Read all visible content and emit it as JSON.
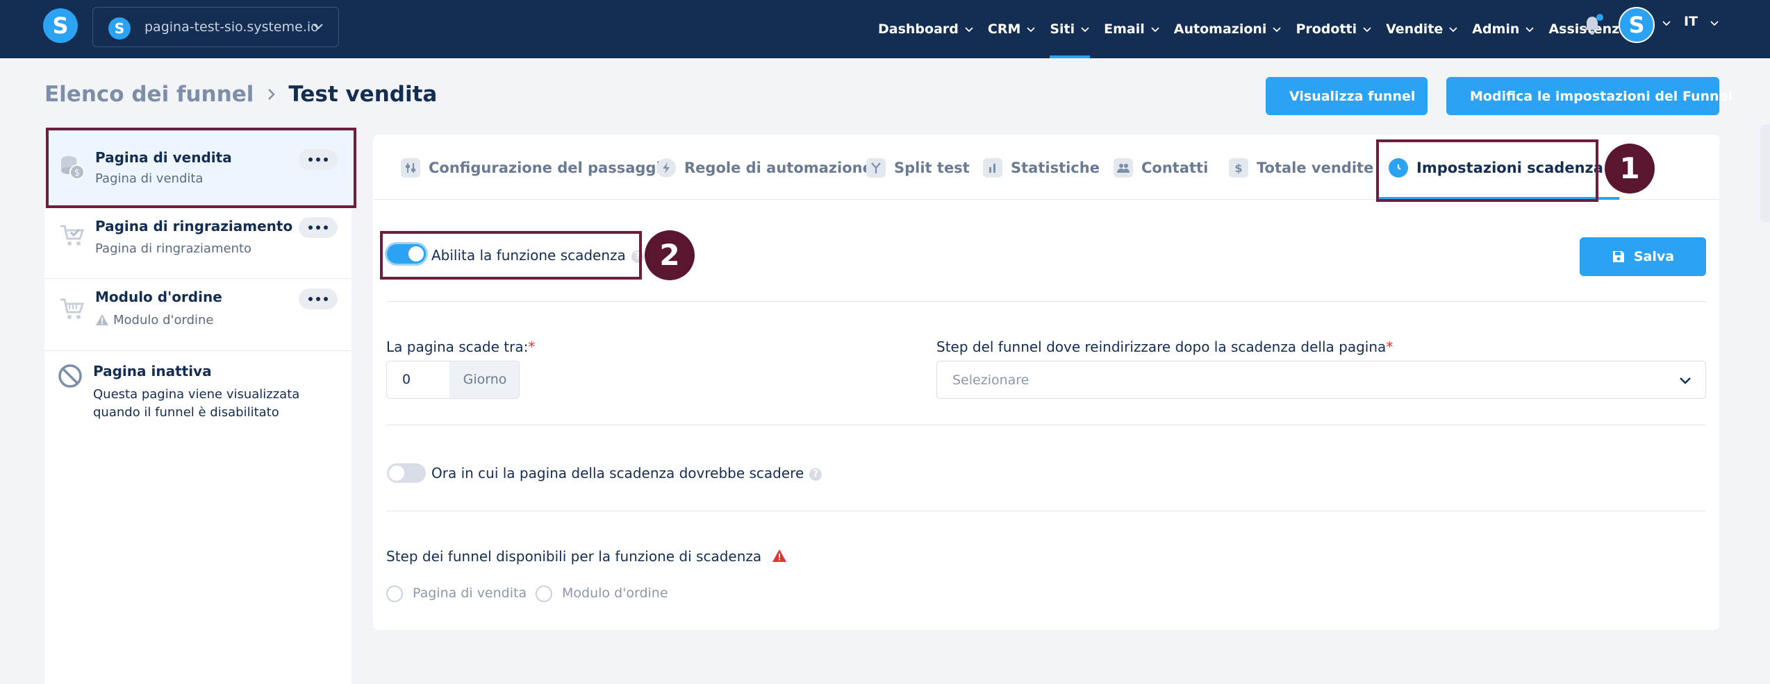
{
  "topbar": {
    "site_name": "pagina-test-sio.systeme.io",
    "nav": [
      {
        "label": "Dashboard",
        "active": false
      },
      {
        "label": "CRM",
        "active": false
      },
      {
        "label": "Siti",
        "active": true
      },
      {
        "label": "Email",
        "active": false
      },
      {
        "label": "Automazioni",
        "active": false
      },
      {
        "label": "Prodotti",
        "active": false
      },
      {
        "label": "Vendite",
        "active": false
      },
      {
        "label": "Admin",
        "active": false
      },
      {
        "label": "Assistenza",
        "active": false
      }
    ],
    "avatar_letter": "S",
    "logo_letter": "S",
    "language": "IT"
  },
  "header": {
    "breadcrumb_parent": "Elenco dei funnel",
    "breadcrumb_current": "Test vendita",
    "view_funnel_label": "Visualizza funnel",
    "edit_settings_label": "Modifica le impostazioni del Funnel"
  },
  "sidebar": {
    "items": [
      {
        "title": "Pagina di vendita",
        "subtitle": "Pagina di vendita",
        "icon": "coins-icon",
        "selected": true
      },
      {
        "title": "Pagina di ringraziamento",
        "subtitle": "Pagina di ringraziamento",
        "icon": "cart-check-icon",
        "selected": false
      },
      {
        "title": "Modulo d'ordine",
        "subtitle": "Modulo d'ordine",
        "icon": "cart-icon",
        "selected": false,
        "warning": true
      },
      {
        "title": "Pagina inattiva",
        "subtitle": "Questa pagina viene visualizzata quando il funnel è disabilitato",
        "icon": "ban-icon",
        "selected": false
      }
    ]
  },
  "tabs": [
    {
      "label": "Configurazione del passaggio",
      "icon": "sliders-icon"
    },
    {
      "label": "Regole di automazione",
      "icon": "bolt-icon"
    },
    {
      "label": "Split test",
      "icon": "split-icon"
    },
    {
      "label": "Statistiche",
      "icon": "bar-chart-icon"
    },
    {
      "label": "Contatti",
      "icon": "users-icon"
    },
    {
      "label": "Totale vendite",
      "icon": "dollar-icon"
    },
    {
      "label": "Impostazioni scadenza",
      "icon": "clock-icon",
      "active": true
    }
  ],
  "settings": {
    "enable_label": "Abilita la funzione scadenza",
    "enable_on": true,
    "save_label": "Salva",
    "expire_after_label": "La pagina scade tra:",
    "expire_after_value": "0",
    "expire_after_unit": "Giorno",
    "redirect_label": "Step del funnel dove reindirizzare dopo la scadenza della pagina",
    "redirect_placeholder": "Selezionare",
    "time_label": "Ora in cui la pagina della scadenza dovrebbe scadere",
    "time_on": false,
    "available_steps_label": "Step dei funnel disponibili per la funzione di scadenza",
    "available_steps": [
      "Pagina di vendita",
      "Modulo d'ordine"
    ],
    "help_glyph": "?",
    "required_mark": "*"
  },
  "annotations": {
    "marker_1": "1",
    "marker_2": "2"
  },
  "colors": {
    "nav_bg": "#142d52",
    "accent": "#2ca3f2",
    "annotation": "#5a1630",
    "warning": "#e0342f"
  }
}
